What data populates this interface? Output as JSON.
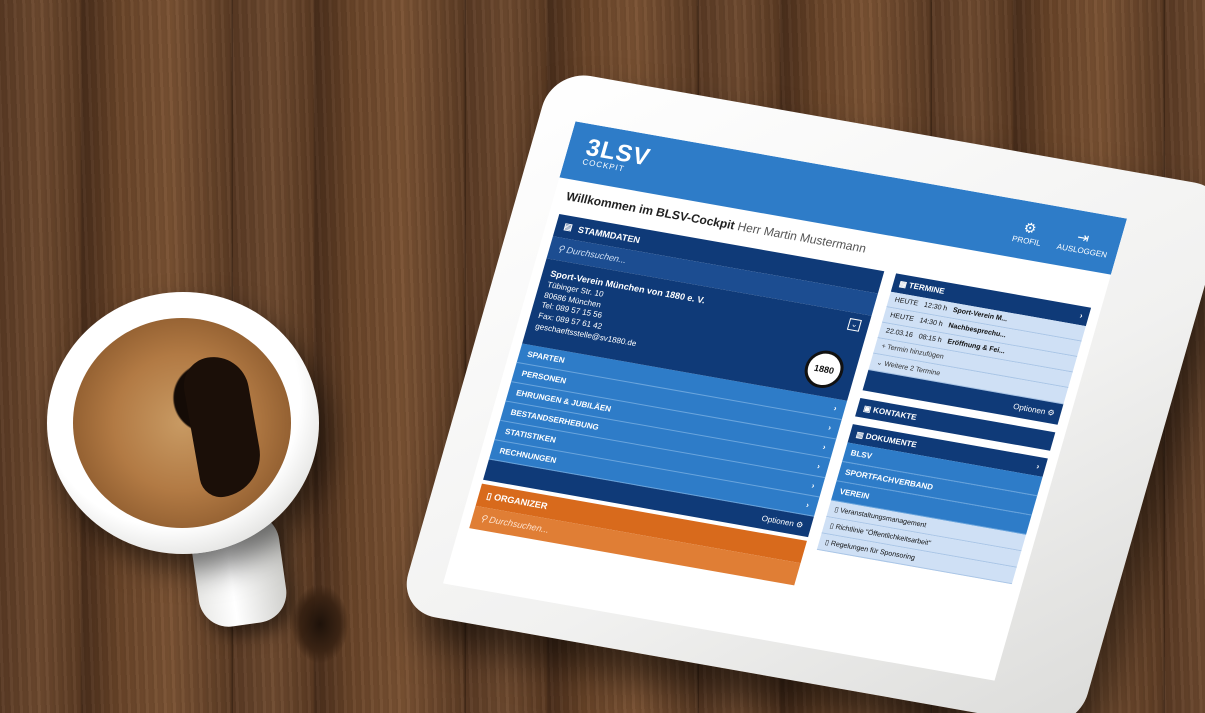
{
  "app": {
    "logo": "3LSV",
    "logo_sub": "COCKPIT",
    "profile_label": "PROFIL",
    "logout_label": "AUSLOGGEN",
    "welcome_bold": "Willkommen im BLSV-Cockpit",
    "welcome_name": "Herr Martin Mustermann"
  },
  "stammdaten": {
    "title": "STAMMDATEN",
    "search_placeholder": "Durchsuchen...",
    "club_name": "Sport-Verein München von 1880 e. V.",
    "street": "Tübinger Str. 10",
    "city": "80686 München",
    "tel": "Tel: 089 57 15 56",
    "fax": "Fax: 089 57 61 42",
    "email": "geschaeftsstelle@sv1880.de",
    "crest": "1880",
    "menu": [
      "SPARTEN",
      "PERSONEN",
      "EHRUNGEN & JUBILÄEN",
      "BESTANDSERHEBUNG",
      "STATISTIKEN",
      "RECHNUNGEN"
    ],
    "options": "Optionen"
  },
  "organizer": {
    "title": "ORGANIZER",
    "search_placeholder": "Durchsuchen..."
  },
  "termine": {
    "title": "TERMINE",
    "rows": [
      {
        "date": "HEUTE",
        "time": "12:30 h",
        "title": "Sport-Verein M..."
      },
      {
        "date": "HEUTE",
        "time": "14:30 h",
        "title": "Nachbesprechu..."
      },
      {
        "date": "22.03.16",
        "time": "08:15 h",
        "title": "Eröffnung & Fei..."
      }
    ],
    "add": "+ Termin hinzufügen",
    "more": "Weitere 2 Termine",
    "options": "Optionen"
  },
  "kontakte": {
    "title": "KONTAKTE"
  },
  "dokumente": {
    "title": "DOKUMENTE",
    "groups": [
      "BLSV",
      "SPORTFACHVERBAND",
      "VEREIN"
    ],
    "items": [
      "Veranstaltungsmanagement",
      "Richtlinie \"Öffentlichkeitsarbeit\"",
      "Regelungen für Sponsoring"
    ]
  }
}
